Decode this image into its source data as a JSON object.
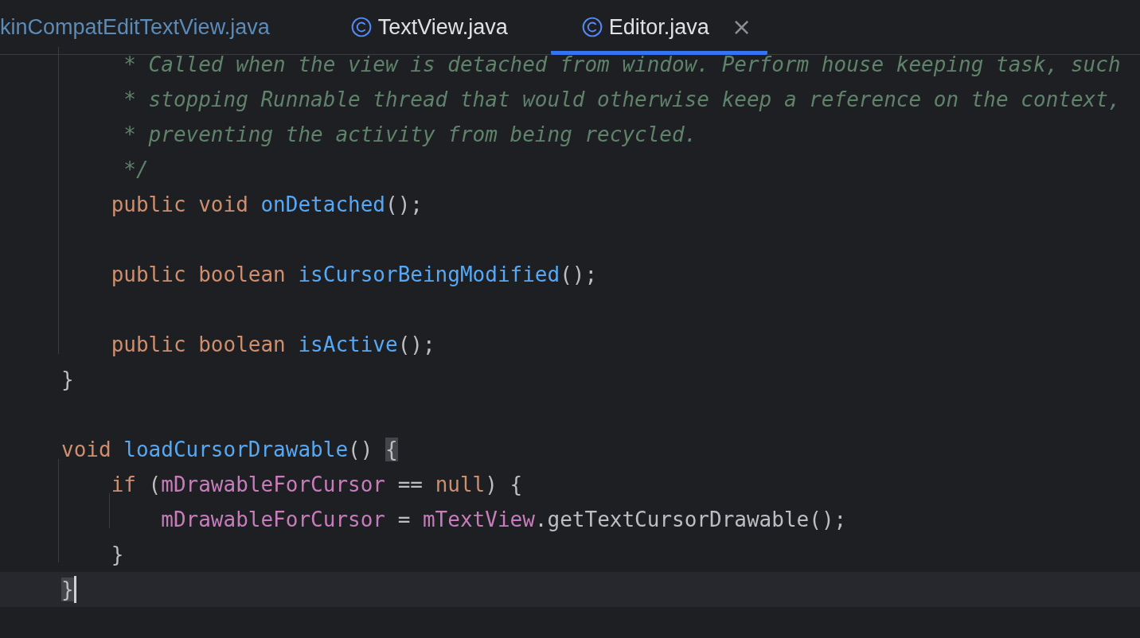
{
  "tabs": [
    {
      "label": "kinCompatEditTextView.java",
      "selected": false,
      "has_icon": false,
      "color": "#5c8bb8"
    },
    {
      "label": "TextView.java",
      "selected": false,
      "has_icon": true,
      "color": "#dfe1e5"
    },
    {
      "label": "Editor.java",
      "selected": true,
      "has_icon": true,
      "color": "#dfe1e5",
      "close": "×"
    }
  ],
  "code_lines": [
    {
      "current": false,
      "tokens": [
        {
          "kind": "comment",
          "text": "     * Called when the view is detached from window. Perform house keeping task, such"
        }
      ]
    },
    {
      "current": false,
      "tokens": [
        {
          "kind": "comment",
          "text": "     * stopping Runnable thread that would otherwise keep a reference on the context,"
        }
      ]
    },
    {
      "current": false,
      "tokens": [
        {
          "kind": "comment",
          "text": "     * preventing the activity from being recycled."
        }
      ]
    },
    {
      "current": false,
      "tokens": [
        {
          "kind": "comment",
          "text": "     */"
        }
      ]
    },
    {
      "current": false,
      "tokens": [
        {
          "kind": "keyword",
          "text": "    public void "
        },
        {
          "kind": "method",
          "text": "onDetached"
        },
        {
          "kind": "plain",
          "text": "();"
        }
      ]
    },
    {
      "current": false
    },
    {
      "current": false,
      "tokens": [
        {
          "kind": "keyword",
          "text": "    public boolean "
        },
        {
          "kind": "method",
          "text": "isCursorBeingModified"
        },
        {
          "kind": "plain",
          "text": "();"
        }
      ]
    },
    {
      "current": false
    },
    {
      "current": false,
      "tokens": [
        {
          "kind": "keyword",
          "text": "    public boolean "
        },
        {
          "kind": "method",
          "text": "isActive"
        },
        {
          "kind": "plain",
          "text": "();"
        }
      ]
    },
    {
      "current": false,
      "tokens": [
        {
          "kind": "plain",
          "text": "}"
        }
      ]
    },
    {
      "current": false
    },
    {
      "current": false,
      "tokens": [
        {
          "kind": "keyword",
          "text": "void "
        },
        {
          "kind": "method",
          "text": "loadCursorDrawable"
        },
        {
          "kind": "plain",
          "text": "() "
        },
        {
          "kind": "matched_brace",
          "text": "{"
        }
      ]
    },
    {
      "current": false,
      "tokens": [
        {
          "kind": "keyword",
          "text": "    if "
        },
        {
          "kind": "plain",
          "text": "("
        },
        {
          "kind": "field",
          "text": "mDrawableForCursor"
        },
        {
          "kind": "plain",
          "text": " == "
        },
        {
          "kind": "keyword",
          "text": "null"
        },
        {
          "kind": "plain",
          "text": ") {"
        }
      ]
    },
    {
      "current": false,
      "tokens": [
        {
          "kind": "field",
          "text": "        mDrawableForCursor"
        },
        {
          "kind": "plain",
          "text": " = "
        },
        {
          "kind": "field",
          "text": "mTextView"
        },
        {
          "kind": "plain",
          "text": ".getTextCursorDrawable();"
        }
      ]
    },
    {
      "current": false,
      "tokens": [
        {
          "kind": "plain",
          "text": "    }"
        }
      ]
    },
    {
      "current": true,
      "tokens": [
        {
          "kind": "matched_brace",
          "text": "}"
        }
      ]
    }
  ]
}
